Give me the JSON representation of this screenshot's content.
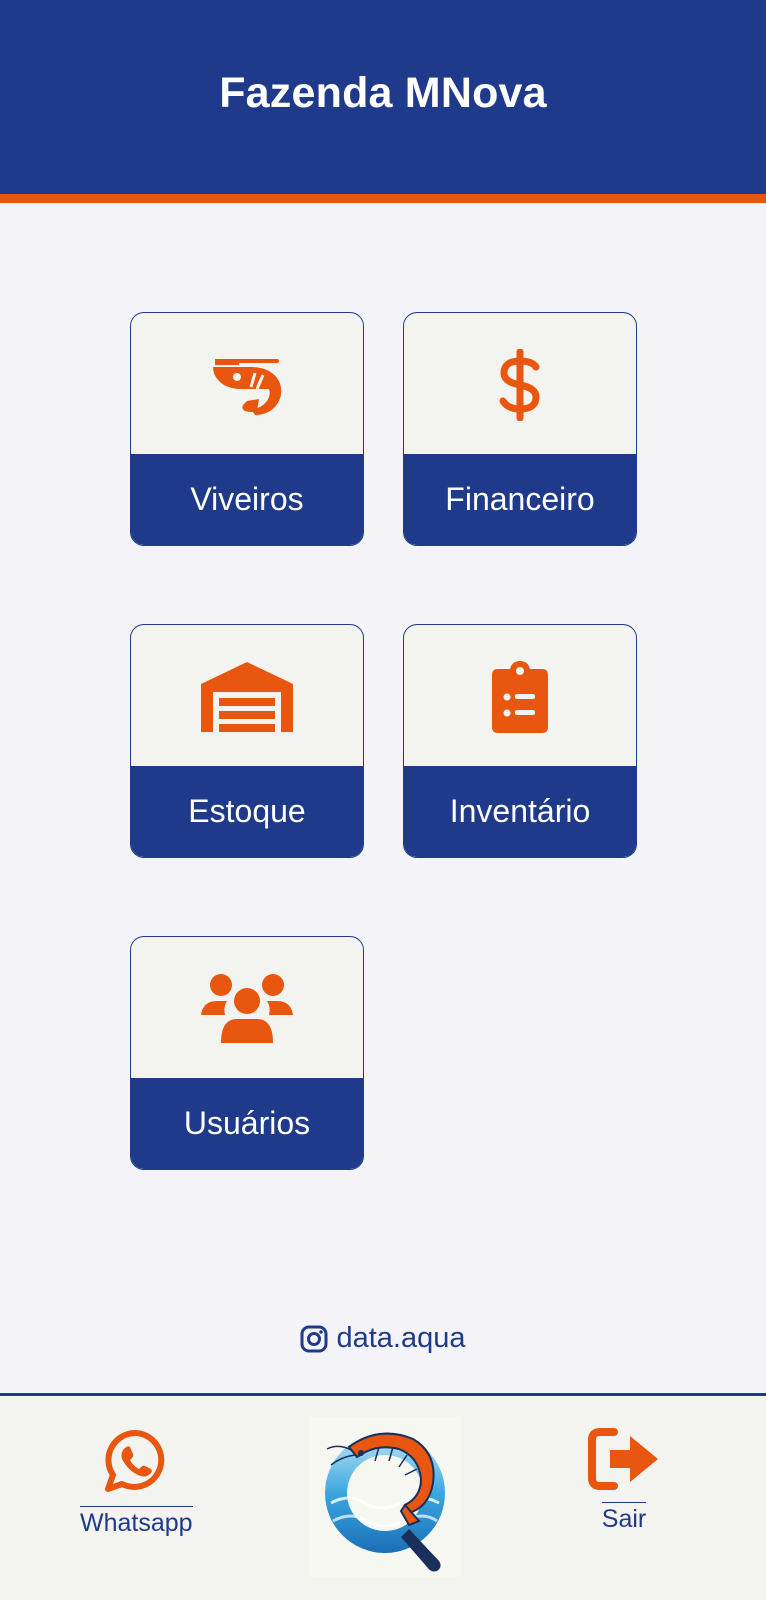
{
  "header": {
    "title": "Fazenda MNova"
  },
  "menu": {
    "tiles": [
      {
        "label": "Viveiros",
        "icon": "shrimp-icon"
      },
      {
        "label": "Financeiro",
        "icon": "dollar-icon"
      },
      {
        "label": "Estoque",
        "icon": "warehouse-icon"
      },
      {
        "label": "Inventário",
        "icon": "clipboard-list-icon"
      },
      {
        "label": "Usuários",
        "icon": "users-icon"
      }
    ]
  },
  "social": {
    "instagram": "data.aqua",
    "icon": "instagram-icon"
  },
  "footer": {
    "whatsapp_label": "Whatsapp",
    "logout_label": "Sair",
    "logo_icon": "app-logo-shrimp-q"
  },
  "colors": {
    "primary": "#1f3a8a",
    "accent": "#e8560f",
    "background": "#f4f4f8",
    "tile_top": "#f3f3ef"
  }
}
